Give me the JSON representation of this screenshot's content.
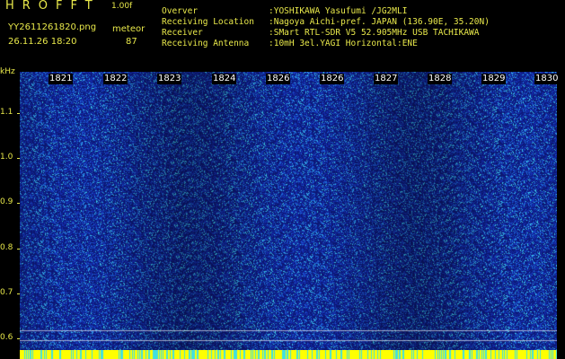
{
  "header": {
    "app_title": "HROFFT",
    "version": "1.00f",
    "filename": "YY2611261820.png",
    "datetime": "26.11.26 18:20",
    "meteor_label": "meteor",
    "meteor_count": "87"
  },
  "info": [
    {
      "key": "Overver",
      "value": ":YOSHIKAWA Yasufumi /JG2MLI"
    },
    {
      "key": "Receiving Location",
      "value": ":Nagoya Aichi-pref. JAPAN (136.90E, 35.20N)"
    },
    {
      "key": "Receiver",
      "value": ":SMart RTL-SDR V5 52.905MHz USB TACHIKAWA"
    },
    {
      "key": "Receiving Antenna",
      "value": ":10mH 3el.YAGI Horizontal:ENE"
    }
  ],
  "axis": {
    "unit": "kHz",
    "y_ticks": [
      "1.1",
      "1.0",
      "0.9",
      "0.8",
      "0.7",
      "0.6"
    ],
    "time_labels": [
      "1821",
      "1822",
      "1823",
      "1824",
      "1826",
      "1826",
      "1827",
      "1828",
      "1829",
      "1830"
    ]
  },
  "colors": {
    "text": "#e8e84a",
    "background": "#000000",
    "spectrogram_base": "#1a2fb0",
    "noise_light": "#3ec8e8",
    "bottom_bar": "#ffff00"
  }
}
